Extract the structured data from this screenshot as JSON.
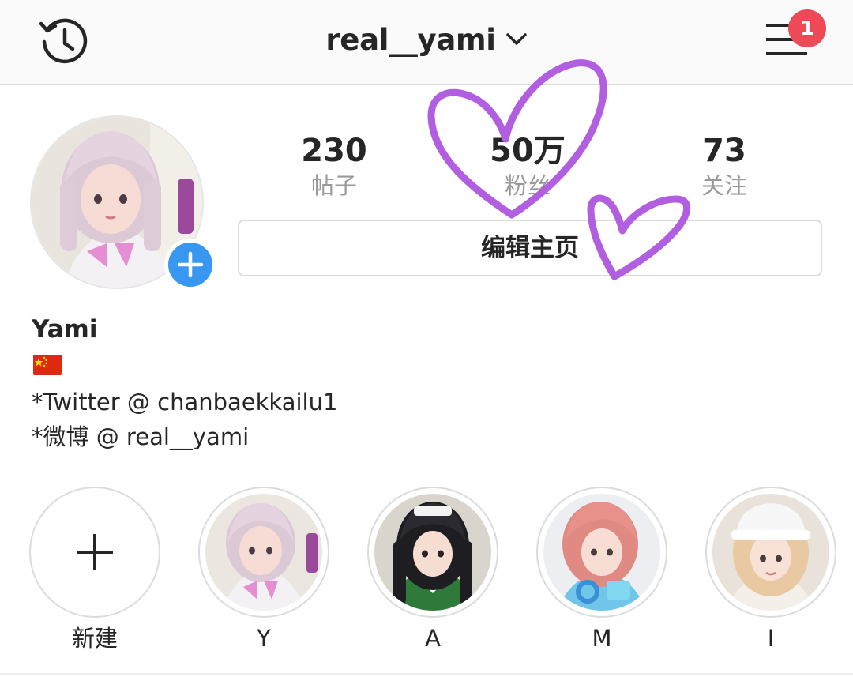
{
  "header": {
    "username": "real__yami",
    "notification_count": "1",
    "icons": {
      "history": "history-clock-icon",
      "dropdown": "chevron-down-icon",
      "menu": "hamburger-menu-icon"
    }
  },
  "profile": {
    "stats": [
      {
        "value": "230",
        "label": "帖子"
      },
      {
        "value": "50万",
        "label": "粉丝"
      },
      {
        "value": "73",
        "label": "关注"
      }
    ],
    "edit_button_label": "编辑主页",
    "display_name": "Yami",
    "flag": "china-flag-icon",
    "bio_lines": [
      "*Twitter @ chanbaekkailu1",
      "*微博 @ real__yami"
    ]
  },
  "highlights": [
    {
      "label": "新建",
      "type": "new"
    },
    {
      "label": "Y",
      "type": "story"
    },
    {
      "label": "A",
      "type": "story"
    },
    {
      "label": "M",
      "type": "story"
    },
    {
      "label": "I",
      "type": "story"
    }
  ],
  "colors": {
    "accent_blue": "#3897f0",
    "badge_red": "#ed4956",
    "heart_purple": "#b25ee0",
    "muted_text": "#999999",
    "border": "#dbdbdb"
  }
}
